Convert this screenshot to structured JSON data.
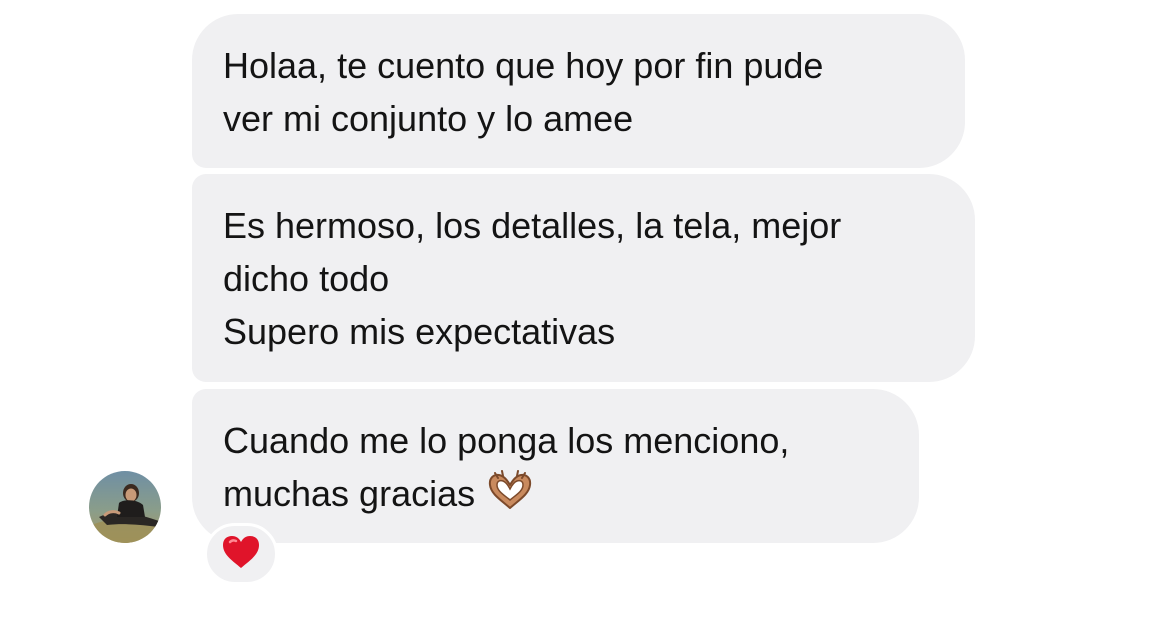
{
  "conversation": {
    "messages": [
      {
        "lines": [
          "Holaa, te cuento que hoy por fin pude",
          "ver mi conjunto y lo amee"
        ]
      },
      {
        "lines": [
          "Es hermoso, los detalles, la tela, mejor",
          "dicho todo",
          "Supero mis expectativas"
        ]
      },
      {
        "lines": [
          "Cuando me lo ponga los menciono,",
          "muchas gracias"
        ],
        "trailing_emoji": "heart-hands-icon"
      }
    ],
    "reaction": {
      "emoji": "red-heart-icon",
      "color": "#e0142a"
    },
    "sender_avatar": "avatar"
  },
  "theme": {
    "bubble_color": "#f0f0f2",
    "text_color": "#141414",
    "background": "#ffffff"
  }
}
